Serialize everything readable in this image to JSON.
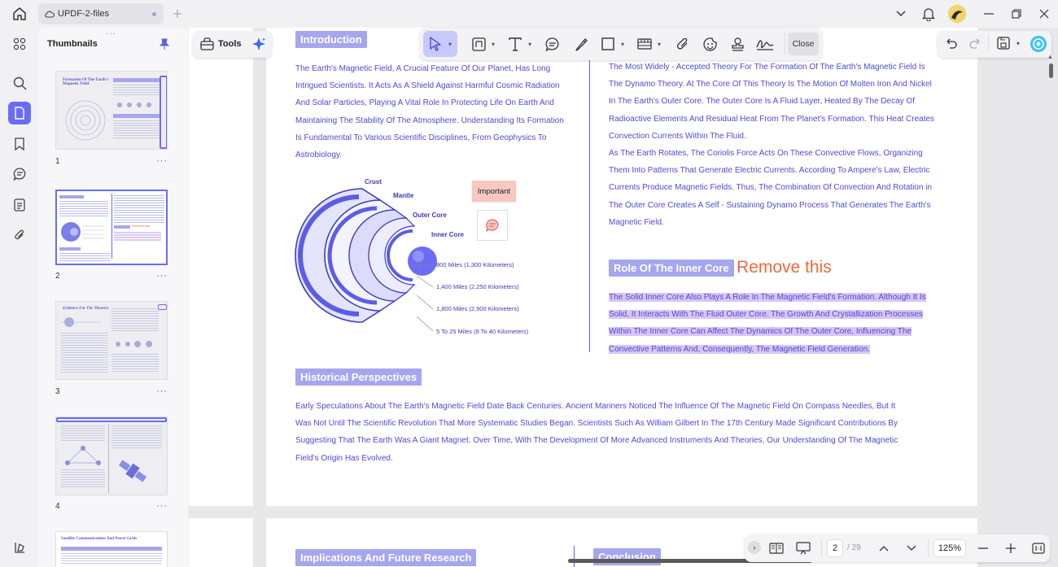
{
  "titlebar": {
    "tab_title": "UPDF-2-files"
  },
  "sidebar": {
    "panel_title": "Thumbnails",
    "pages": [
      "1",
      "2",
      "3",
      "4"
    ],
    "more": "···"
  },
  "tools": {
    "label": "Tools"
  },
  "toolbar": {
    "close_label": "Close"
  },
  "document": {
    "intro": {
      "heading": "Introduction",
      "lines": [
        "The Earth's Magnetic Field, A Crucial Feature Of Our Planet, Has Long",
        "Intrigued Scientists. It Acts As A Shield Against Harmful Cosmic Radiation",
        "And Solar Particles, Playing A Vital Role In Protecting Life On Earth And",
        "Maintaining The Stability Of The Atmosphere. Understanding Its Formation",
        "Is Fundamental To Various Scientific Disciplines, From Geophysics To",
        "Astrobiology."
      ]
    },
    "diagram": {
      "labels": {
        "crust": "Crust",
        "mantle": "Mantle",
        "outer_core": "Outer Core",
        "inner_core": "Inner Core"
      },
      "distances": [
        "800 Miles (1,300 Kilometers)",
        "1,400 Miles (2,250 Kilometers)",
        "1,800 Miles (2,900 Kilometers)",
        "5 To 25 Miles (8 To 40 Kilometers)"
      ],
      "sticky_note": "Important"
    },
    "theory": {
      "lines": [
        "The Most Widely - Accepted Theory For The Formation Of The Earth's Magnetic Field Is",
        "The Dynamo Theory. At The Core Of This Theory Is The Motion Of Molten Iron And Nickel",
        "In The Earth's Outer Core. The Outer Core Is A Fluid Layer, Heated By The Decay Of",
        "Radioactive Elements And Residual Heat From The Planet's Formation. This Heat Creates",
        "Convection Currents Within The Fluid.",
        "As The Earth Rotates, The Coriolis Force Acts On These Convective Flows, Organizing",
        "Them Into Patterns That Generate Electric Currents. According To Ampere's Law, Electric",
        "Currents Produce Magnetic Fields. Thus, The Combination Of Convection And Rotation in",
        "The Outer Core Creates A Self - Sustaining Dynamo Process That Generates The Earth's",
        "Magnetic Field."
      ]
    },
    "inner_core": {
      "heading": "Role Of The Inner Core",
      "annotation": "Remove this",
      "lines": [
        "The Solid Inner Core Also Plays A Role In The Magnetic Field's Formation. Although It Is",
        "Solid, It Interacts With The Fluid Outer Core. The Growth And Crystallization Processes",
        "Within The Inner Core Can Affect The Dynamics Of The Outer Core, Influencing The",
        "Convective Patterns And, Consequently, The Magnetic Field Generation."
      ]
    },
    "historical": {
      "heading": "Historical Perspectives",
      "lines": [
        "Early Speculations About The Earth's Magnetic Field Date Back Centuries. Ancient Mariners Noticed The Influence Of The Magnetic Field On Compass Needles, But It",
        "Was Not Until The Scientific Revolution That More Systematic Studies Began. Scientists Such As William Gilbert In The 17th Century Made Significant Contributions By",
        "Suggesting That The Earth Was A Giant Magnet. Over Time, With The Development Of More Advanced Instruments And Theories, Our Understanding Of The Magnetic",
        "Field's Origin Has Evolved."
      ]
    },
    "next_page": {
      "heading_left": "Implications And Future Research",
      "heading_right": "Conclusion"
    }
  },
  "thumb_text": {
    "t1": "Formation Of The Earth's Magnetic Field",
    "t2": "Remove this",
    "t3": "Evidence For The Theories",
    "t5": "Satellite Communications And Power Grids"
  },
  "bottombar": {
    "page_current": "2",
    "page_total": "/ 29",
    "zoom": "125%"
  },
  "colors": {
    "accent": "#6b6cf6",
    "section_heading": "#a6a6f0",
    "body_text": "#4b4bd6",
    "highlight": "#d9c6f5",
    "annotation": "#f0673a",
    "sticky": "#f8c8c0"
  }
}
